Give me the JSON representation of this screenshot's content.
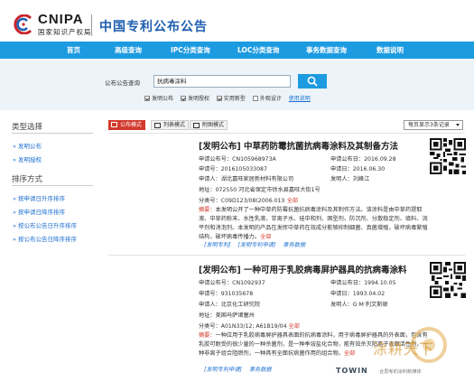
{
  "header": {
    "logo_text": "CNIPA",
    "logo_sub": "国家知识产权局",
    "site_title": "中国专利公布公告"
  },
  "nav": {
    "items": [
      "首页",
      "高级查询",
      "IPC分类查询",
      "LOC分类查询",
      "事务数据查询",
      "数据说明"
    ]
  },
  "search": {
    "label": "公布公告查询",
    "value": "抗病毒涂料",
    "options": [
      {
        "label": "发明公布",
        "checked": true
      },
      {
        "label": "发明授权",
        "checked": true
      },
      {
        "label": "实用新型",
        "checked": true
      },
      {
        "label": "外观设计",
        "checked": false
      }
    ],
    "help_link": "使用说明"
  },
  "sidebar": {
    "type_heading": "类型选择",
    "type_items": [
      "» 发明公布",
      "» 发明授权"
    ],
    "sort_heading": "排序方式",
    "sort_items": [
      "» 按申请日升序排序",
      "» 按申请日降序排序",
      "» 按公布公告日升序排序",
      "» 按公布公告日降序排序"
    ]
  },
  "view_tabs": [
    "公布模式",
    "列表模式",
    "附图模式"
  ],
  "per_page": "每页显示3条记录",
  "results": [
    {
      "title": "[发明公布] 中草药防霉抗菌抗病毒涂料及其制备方法",
      "pub_no": "CN105968973A",
      "pub_date": "2016.09.28",
      "app_no": "2016105033087",
      "app_date": "2016.06.30",
      "applicant": "湖北嘉旺家居新材料有限公司",
      "inventor": "刘峰江",
      "address": "072550 河北省保定市徐水县嘉旺大街1号",
      "ipc": "C09D123/08(2006.01)I",
      "ipc_more": "全部",
      "abstract_label": "摘要：",
      "abstract": "本发明公开了一种中草药防霉抗菌抗病毒涂料及其制作方法。该涂料是由中草药提取液、中草药粉末、水性乳液、甘离子水、硅中和剂、固型剂、防沉剂、分散稳定剂、填料、流平剂和消泡剂。本发明的产品在发挥中草药在效成分能够抑制细菌、真菌增殖，破坏病毒繁殖结构，破坏病毒传播力。",
      "abstract_more": "全部",
      "links": [
        "[发明专利]",
        "[发明专利申请]",
        "事务数据"
      ]
    },
    {
      "title": "[发明公布] 一种可用于乳胶病毒屏护器具的抗病毒涂料",
      "pub_no": "CN1092937",
      "pub_date": "1994.10.05",
      "app_no": "931035678",
      "app_date": "1993.04.02",
      "applicant": "北京化工研究院",
      "inventor": "G·M·利文斯顿",
      "address": "美国马萨诸塞州",
      "ipc": "A01N33/12; A61B19/04",
      "ipc_more": "全部",
      "abstract_label": "摘要：",
      "abstract": "一种应用于乳胶病毒屏护器具表面的抗病毒涂料，用于病毒屏护器具的外表面，包含有乳胶可耐受的很少量的一种杀菌剂，是一种季铵盐化合物，能有效杀灭阳离子表面活性剂，一种非离子组合阻燃剂，一种具有全面抗病菌作用的组合物。",
      "abstract_more": "全部",
      "links": [
        "[发明专利申请]",
        "事务数据"
      ]
    }
  ],
  "watermark": {
    "brand": "TOWIN",
    "tagline": "合思考的涂料新媒体",
    "cn_name": "涂耕天下"
  }
}
